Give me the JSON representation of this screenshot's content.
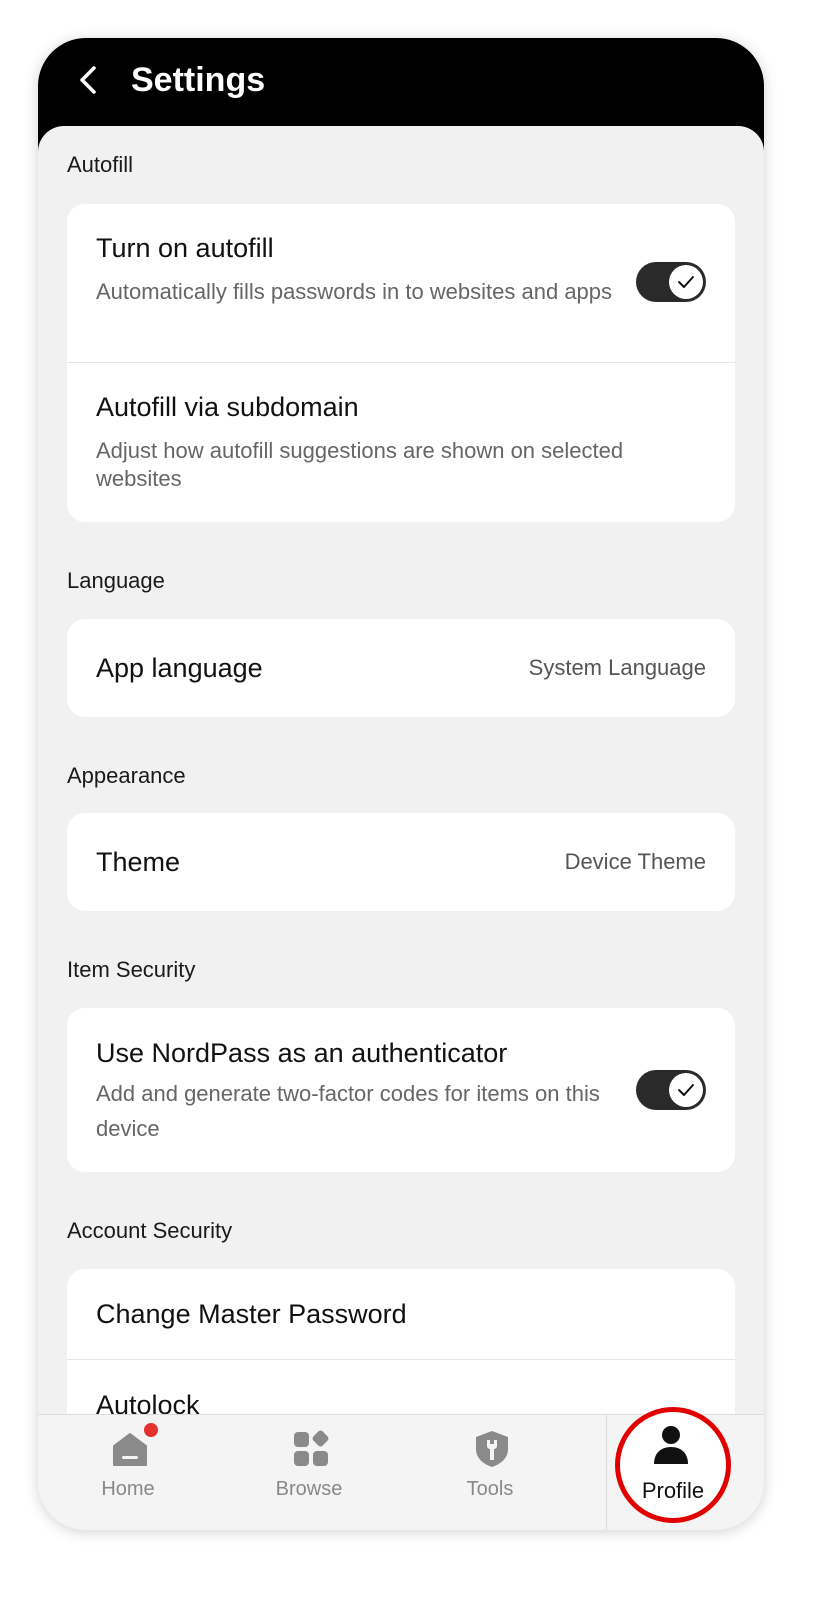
{
  "header": {
    "title": "Settings"
  },
  "sections": {
    "autofill": {
      "title": "Autofill",
      "turn_on": {
        "title": "Turn on autofill",
        "description": "Automatically fills passwords in to websites and apps",
        "enabled": true
      },
      "subdomain": {
        "title": "Autofill via subdomain",
        "description": "Adjust how autofill suggestions are shown on selected websites"
      }
    },
    "language": {
      "title": "Language",
      "app_language": {
        "title": "App language",
        "value": "System Language"
      }
    },
    "appearance": {
      "title": "Appearance",
      "theme": {
        "title": "Theme",
        "value": "Device Theme"
      }
    },
    "item_security": {
      "title": "Item Security",
      "authenticator": {
        "title": "Use NordPass as an authenticator",
        "description": "Add and generate two-factor codes for items on this device",
        "enabled": true
      }
    },
    "account_security": {
      "title": "Account Security",
      "change_master_password": {
        "title": "Change Master Password"
      },
      "autolock": {
        "title": "Autolock"
      }
    }
  },
  "tabbar": {
    "home": {
      "label": "Home",
      "icon": "home-icon",
      "has_notification": true
    },
    "browse": {
      "label": "Browse",
      "icon": "browse-icon"
    },
    "tools": {
      "label": "Tools",
      "icon": "shield-icon"
    },
    "profile": {
      "label": "Profile",
      "icon": "person-icon",
      "highlight_color": "#e10000"
    }
  }
}
